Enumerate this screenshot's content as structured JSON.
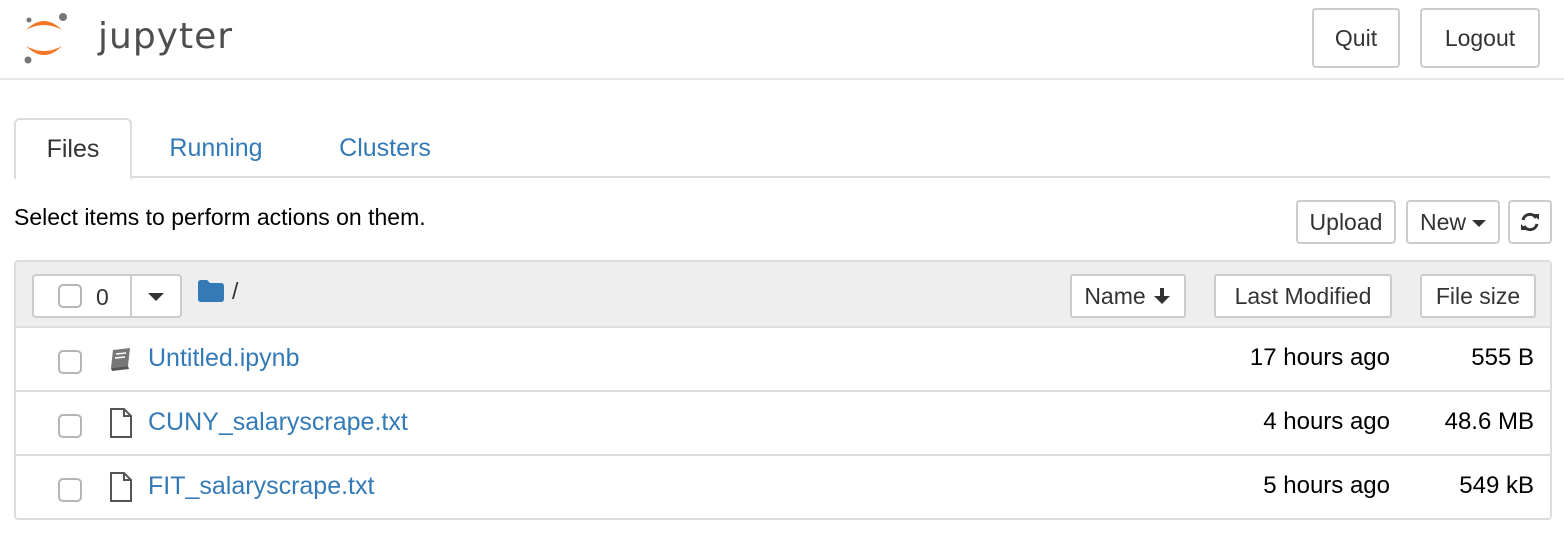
{
  "header": {
    "logo_text": "jupyter",
    "quit_label": "Quit",
    "logout_label": "Logout",
    "logo_colors": {
      "orange": "#F37726",
      "gray": "#767677"
    }
  },
  "tabs": [
    {
      "label": "Files",
      "active": true
    },
    {
      "label": "Running",
      "active": false
    },
    {
      "label": "Clusters",
      "active": false
    }
  ],
  "toolbar": {
    "hint": "Select items to perform actions on them.",
    "upload_label": "Upload",
    "new_label": "New",
    "refresh_icon": "refresh-icon"
  },
  "list_header": {
    "selected_count": "0",
    "path": "/",
    "sort_name_label": "Name",
    "sort_modified_label": "Last Modified",
    "sort_size_label": "File size"
  },
  "files": [
    {
      "name": "Untitled.ipynb",
      "type": "notebook",
      "icon": "notebook-icon",
      "modified": "17 hours ago",
      "size": "555 B"
    },
    {
      "name": "CUNY_salaryscrape.txt",
      "type": "file",
      "icon": "file-icon",
      "modified": "4 hours ago",
      "size": "48.6 MB"
    },
    {
      "name": "FIT_salaryscrape.txt",
      "type": "file",
      "icon": "file-icon",
      "modified": "5 hours ago",
      "size": "549 kB"
    }
  ],
  "colors": {
    "link": "#337ab7",
    "border": "#dddddd",
    "header_bg": "#eeeeee",
    "folder": "#337ab7"
  }
}
